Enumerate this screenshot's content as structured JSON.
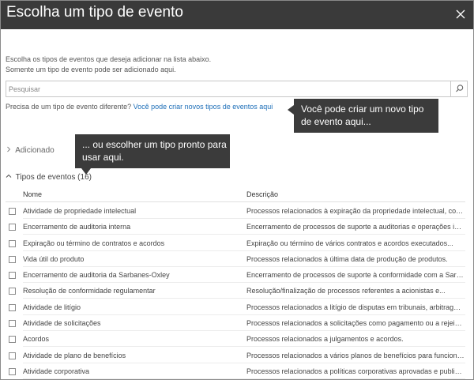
{
  "dialog": {
    "title": "Escolha um tipo de evento",
    "intro_line1": "Escolha os tipos de eventos que deseja adicionar na lista abaixo.",
    "intro_line2": "Somente um tipo de evento pode ser adicionado aqui."
  },
  "search": {
    "placeholder": "Pesquisar"
  },
  "need": {
    "text": "Precisa de um tipo de evento diferente?",
    "link": "Você pode criar novos tipos de eventos aqui"
  },
  "callouts": {
    "create_line1": "Você pode criar um novo tipo",
    "create_line2": "de evento aqui...",
    "choose_line1": "... ou escolher um tipo pronto para",
    "choose_line2": "usar aqui."
  },
  "sections": {
    "added": "Adicionado",
    "types": "Tipos de eventos (16)"
  },
  "table": {
    "col_name": "Nome",
    "col_desc": "Descrição",
    "rows": [
      {
        "name": "Atividade de propriedade intelectual",
        "desc": "Processos relacionados à expiração da propriedade intelectual, como..."
      },
      {
        "name": "Encerramento de auditoria interna",
        "desc": "Encerramento de processos de suporte a auditorias e operações inte..."
      },
      {
        "name": "Expiração ou término de contratos e acordos",
        "desc": "Expiração ou término de vários contratos e acordos executados..."
      },
      {
        "name": "Vida útil do produto",
        "desc": "Processos relacionados à última data de produção de produtos."
      },
      {
        "name": "Encerramento de auditoria da Sarbanes-Oxley",
        "desc": "Encerramento de processos de suporte à conformidade com a Sarba..."
      },
      {
        "name": "Resolução de conformidade regulamentar",
        "desc": "Resolução/finalização de processos referentes a acionistas e..."
      },
      {
        "name": "Atividade de litígio",
        "desc": "Processos relacionados a litígio de disputas em tribunais, arbitragem..."
      },
      {
        "name": "Atividade de solicitações",
        "desc": "Processos relacionados a solicitações como pagamento ou a rejeição..."
      },
      {
        "name": "Acordos",
        "desc": "Processos relacionados a julgamentos e acordos."
      },
      {
        "name": "Atividade de plano de benefícios",
        "desc": "Processos relacionados a vários planos de benefícios para funcionários."
      },
      {
        "name": "Atividade corporativa",
        "desc": "Processos relacionados a políticas corporativas aprovadas e publicad..."
      }
    ]
  },
  "colors": {
    "titlebar": "#3a3a3a",
    "link": "#1e6fb8",
    "callout": "#3b3b3b"
  }
}
